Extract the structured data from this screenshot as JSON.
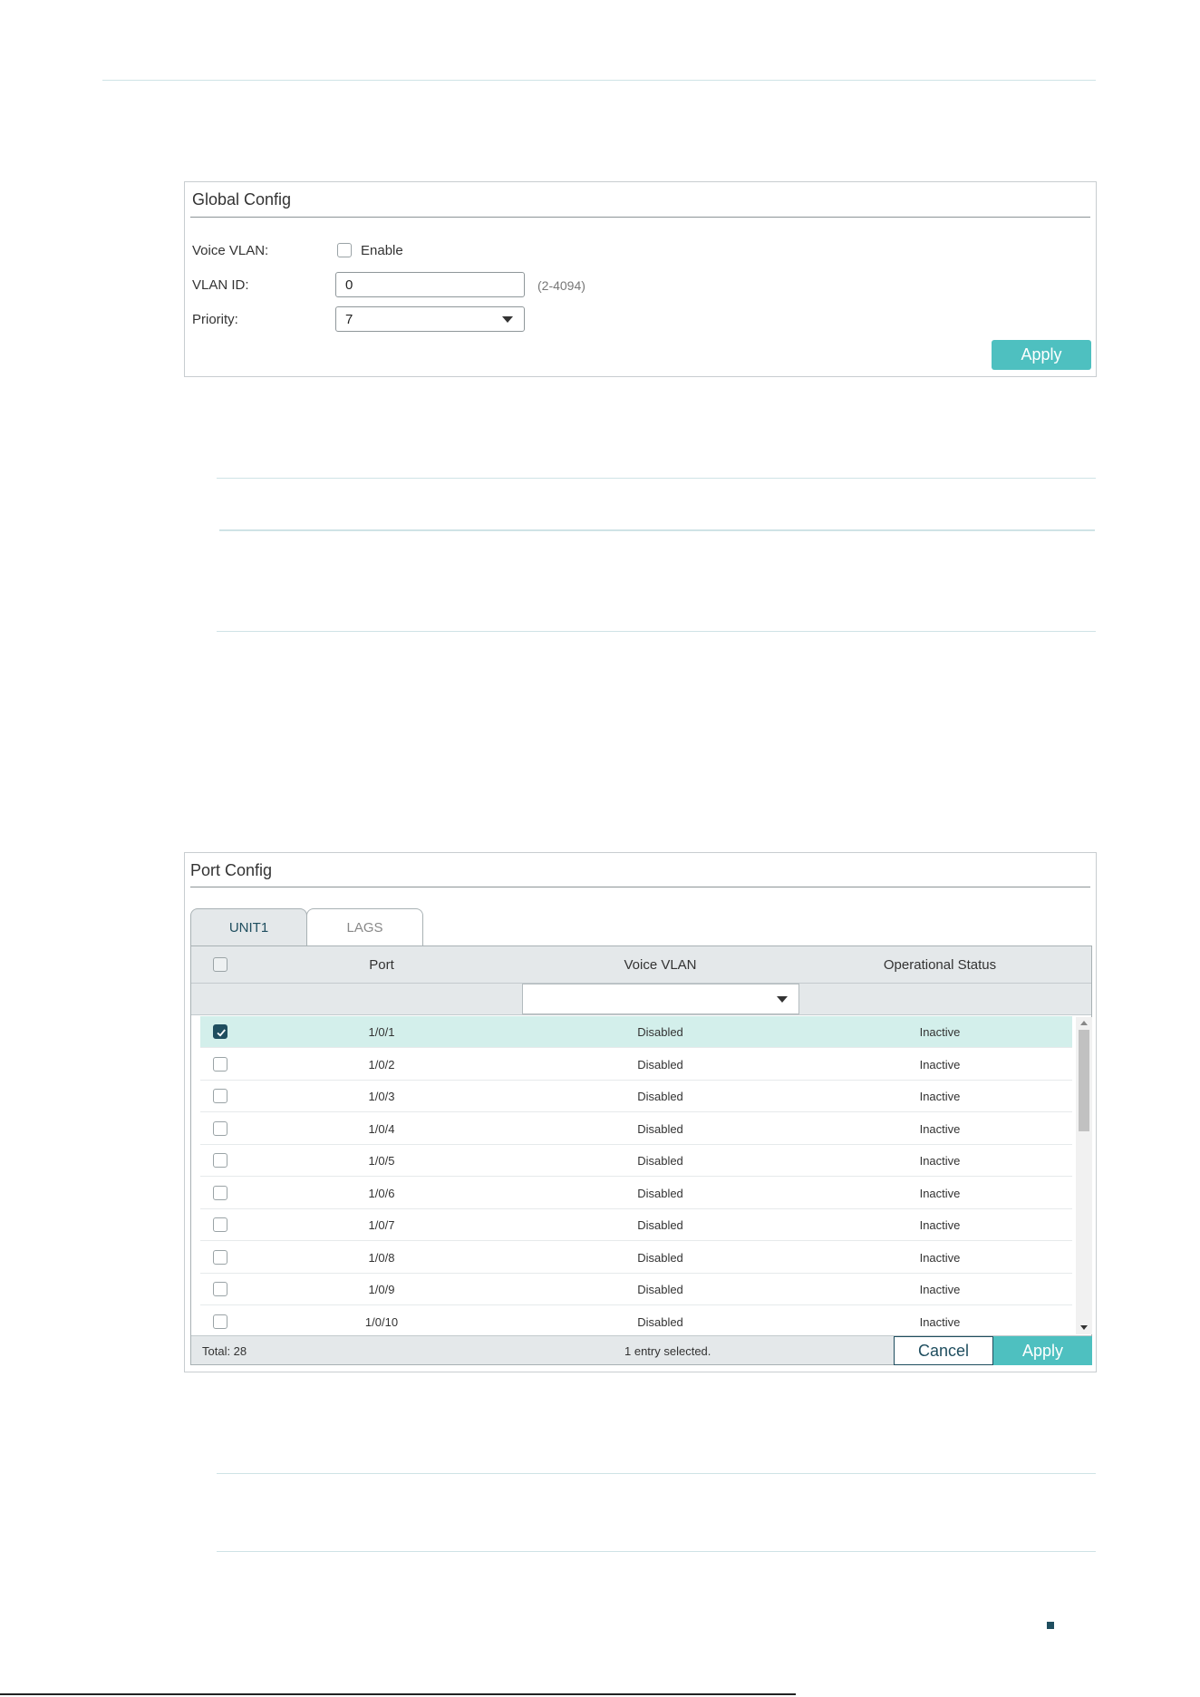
{
  "global_config": {
    "title": "Global Config",
    "voice_vlan_label": "Voice VLAN:",
    "enable_label": "Enable",
    "vlan_id_label": "VLAN ID:",
    "vlan_id_value": "0",
    "vlan_id_range": "(2-4094)",
    "priority_label": "Priority:",
    "priority_value": "7",
    "apply_label": "Apply"
  },
  "port_config": {
    "title": "Port Config",
    "tabs": [
      {
        "label": "UNIT1",
        "active": true
      },
      {
        "label": "LAGS",
        "active": false
      }
    ],
    "columns": [
      "Port",
      "Voice VLAN",
      "Operational Status"
    ],
    "rows": [
      {
        "port": "1/0/1",
        "voice_vlan": "Disabled",
        "status": "Inactive",
        "checked": true
      },
      {
        "port": "1/0/2",
        "voice_vlan": "Disabled",
        "status": "Inactive",
        "checked": false
      },
      {
        "port": "1/0/3",
        "voice_vlan": "Disabled",
        "status": "Inactive",
        "checked": false
      },
      {
        "port": "1/0/4",
        "voice_vlan": "Disabled",
        "status": "Inactive",
        "checked": false
      },
      {
        "port": "1/0/5",
        "voice_vlan": "Disabled",
        "status": "Inactive",
        "checked": false
      },
      {
        "port": "1/0/6",
        "voice_vlan": "Disabled",
        "status": "Inactive",
        "checked": false
      },
      {
        "port": "1/0/7",
        "voice_vlan": "Disabled",
        "status": "Inactive",
        "checked": false
      },
      {
        "port": "1/0/8",
        "voice_vlan": "Disabled",
        "status": "Inactive",
        "checked": false
      },
      {
        "port": "1/0/9",
        "voice_vlan": "Disabled",
        "status": "Inactive",
        "checked": false
      },
      {
        "port": "1/0/10",
        "voice_vlan": "Disabled",
        "status": "Inactive",
        "checked": false
      }
    ],
    "total_label": "Total: 28",
    "selected_label": "1 entry selected.",
    "cancel_label": "Cancel",
    "apply_label": "Apply"
  },
  "colors": {
    "accent": "#4ec0c0",
    "selected_row": "#d3efeb",
    "dark_teal": "#1f4e5f"
  }
}
